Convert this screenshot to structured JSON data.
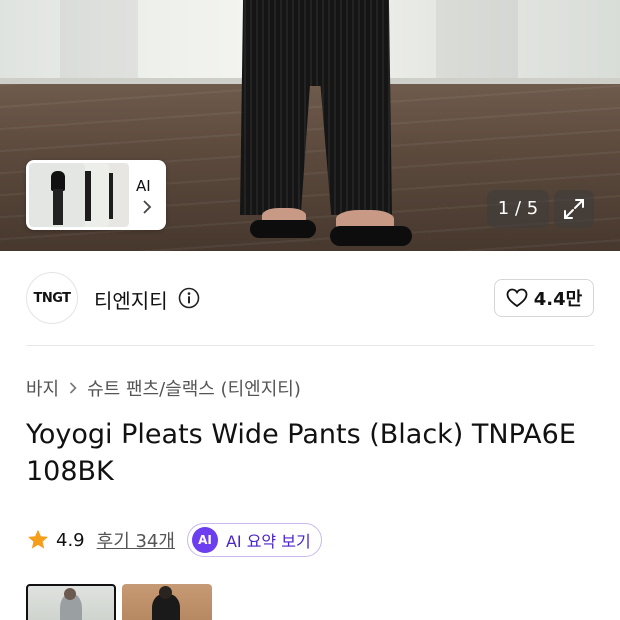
{
  "hero": {
    "thumbnail_card": {
      "label": "AI"
    },
    "pager": "1 / 5",
    "icons": {
      "expand": "expand-icon",
      "chevron": "chevron-right-icon"
    }
  },
  "brand": {
    "logo_text": "TNGT",
    "name": "티엔지티",
    "info_icon": "info-icon",
    "likes": "4.4만",
    "like_icon": "heart-icon"
  },
  "breadcrumb": [
    "바지",
    "슈트 팬츠/슬랙스 (티엔지티)"
  ],
  "product": {
    "title": "Yoyogi Pleats Wide Pants (Black) TNPA6E 108BK",
    "rating": "4.9",
    "reviews_label": "후기 34개",
    "ai_summary": {
      "badge": "AI",
      "label": "AI 요약 보기"
    }
  },
  "colors": {
    "accent": "#6d3df0",
    "star": "#f59e1b",
    "ai_border": "#c9b8f2"
  }
}
